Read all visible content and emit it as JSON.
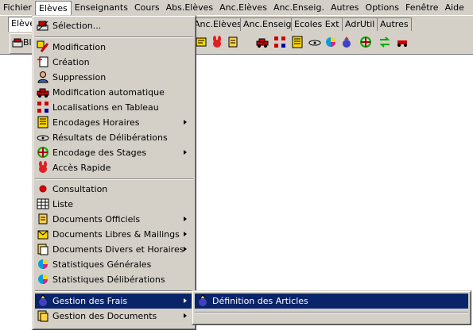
{
  "menubar": [
    {
      "label": "Fichier"
    },
    {
      "label": "Elèves",
      "active": true
    },
    {
      "label": "Enseignants"
    },
    {
      "label": "Cours"
    },
    {
      "label": "Abs.Elèves"
    },
    {
      "label": "Anc.Elèves"
    },
    {
      "label": "Anc.Enseig."
    },
    {
      "label": "Autres"
    },
    {
      "label": "Options"
    },
    {
      "label": "Fenêtre"
    },
    {
      "label": "Aide"
    }
  ],
  "tabs": {
    "left": "Elève",
    "items": [
      "Anc.Elèves",
      "Anc.Enseig",
      "Ecoles Ext",
      "AdrUtil",
      "Autres"
    ]
  },
  "toolbar": {
    "first_label": "Bl"
  },
  "eleves_menu": {
    "items": [
      {
        "label": "Sélection...",
        "icon": "selection-icon"
      },
      {
        "label": "Modification",
        "icon": "modification-icon"
      },
      {
        "label": "Création",
        "icon": "creation-icon"
      },
      {
        "label": "Suppression",
        "icon": "suppression-icon"
      },
      {
        "label": "Modification automatique",
        "icon": "car-icon"
      },
      {
        "label": "Localisations en Tableau",
        "icon": "grid-icon"
      },
      {
        "label": "Encodages Horaires",
        "icon": "schedule-icon",
        "submenu": true
      },
      {
        "label": "Résultats de Délibérations",
        "icon": "eye-icon"
      },
      {
        "label": "Encodage des Stages",
        "icon": "stages-icon",
        "submenu": true
      },
      {
        "label": "Accès Rapide",
        "icon": "rabbit-icon"
      },
      {
        "label": "Consultation",
        "icon": "red-dot-icon"
      },
      {
        "label": "Liste",
        "icon": "table-icon"
      },
      {
        "label": "Documents Officiels",
        "icon": "document-icon",
        "submenu": true
      },
      {
        "label": "Documents Libres  & Mailings",
        "icon": "mailing-icon",
        "submenu": true
      },
      {
        "label": "Documents Divers et Horaires",
        "icon": "documents-divers-icon",
        "submenu": true
      },
      {
        "label": "Statistiques Générales",
        "icon": "pie-chart-icon"
      },
      {
        "label": "Statistiques Délibérations",
        "icon": "pie-chart-icon"
      },
      {
        "label": "Gestion des Frais",
        "icon": "money-bag-icon",
        "submenu": true,
        "highlighted": true
      },
      {
        "label": "Gestion des Documents",
        "icon": "documents-icon",
        "submenu": true
      }
    ]
  },
  "frais_submenu": {
    "items": [
      {
        "label": "Définition des Articles",
        "icon": "money-bag-icon",
        "highlighted": true
      }
    ]
  },
  "colors": {
    "highlight": "#0a246a",
    "face": "#d4d0c8"
  }
}
